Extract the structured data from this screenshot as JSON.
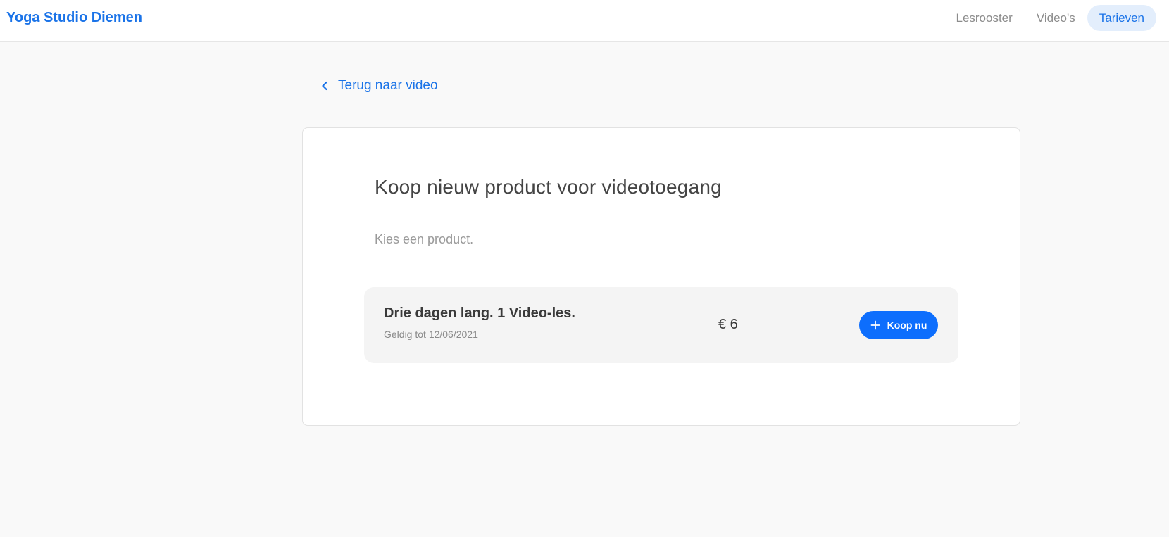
{
  "header": {
    "brand": "Yoga Studio Diemen",
    "nav": [
      {
        "label": "Lesrooster",
        "active": false
      },
      {
        "label": "Video's",
        "active": false
      },
      {
        "label": "Tarieven",
        "active": true
      }
    ]
  },
  "back_link": {
    "label": "Terug naar video",
    "icon": "chevron-left-icon"
  },
  "card": {
    "title": "Koop nieuw product voor videotoegang",
    "subtitle": "Kies een product.",
    "product": {
      "name": "Drie dagen lang. 1 Video-les.",
      "valid": "Geldig tot 12/06/2021",
      "price": "€ 6",
      "button_label": "Koop nu",
      "button_icon": "plus-icon"
    }
  },
  "colors": {
    "accent": "#1a73e8",
    "button": "#0d6efd",
    "nav_active_bg": "#e3eefc",
    "page_bg": "#f9f9f9"
  }
}
